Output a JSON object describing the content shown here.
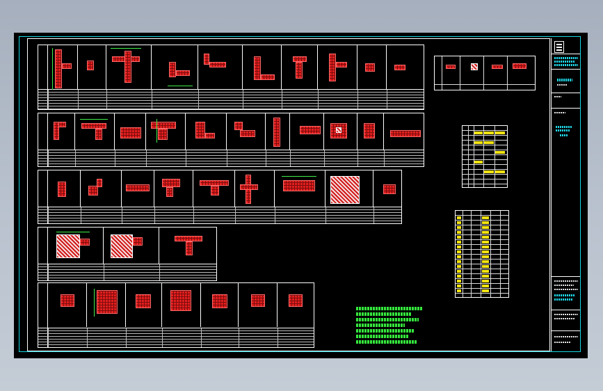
{
  "window": {
    "title": ""
  },
  "colors": {
    "background_top": "#a6afbd",
    "sheet": "#000000",
    "border": "#19d8e3",
    "frame": "#ffffff",
    "column_fill": "#e31e1e",
    "dimension": "#3ef04a",
    "notes": "#34e83c",
    "table_highlight": "#f2e311"
  },
  "drawing": {
    "type": "structural column detail sheet (CAD)",
    "detail_rows": [
      {
        "row": 1,
        "columns": 11
      },
      {
        "row": 2,
        "columns": 11
      },
      {
        "row": 3,
        "columns": 9
      },
      {
        "row": 4,
        "columns": 3
      },
      {
        "row": 5,
        "columns": 7
      }
    ]
  },
  "title_block": {
    "present": true
  }
}
